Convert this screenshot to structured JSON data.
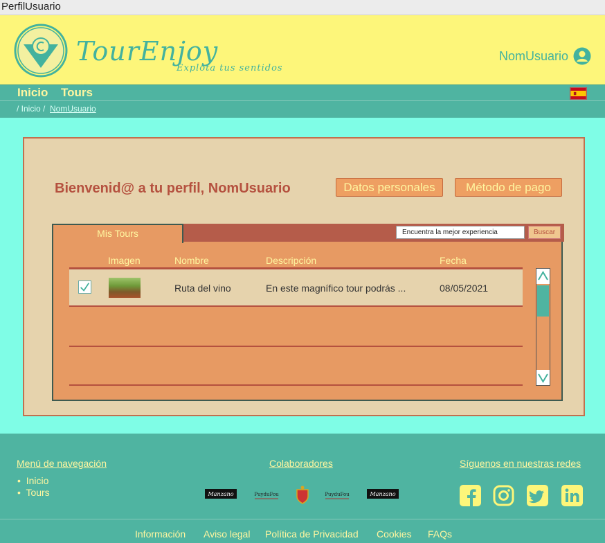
{
  "window": {
    "title": "PerfilUsuario"
  },
  "header": {
    "brand": "TourEnjoy",
    "tagline": "Explota tus sentidos",
    "user": "NomUsuario"
  },
  "nav": {
    "items": [
      "Inicio",
      "Tours"
    ],
    "language": "es"
  },
  "breadcrumb": {
    "root": "/ Inicio /",
    "current": "NomUsuario"
  },
  "profile": {
    "welcome": "Bienvenid@ a tu perfil, NomUsuario",
    "buttons": {
      "personal": "Datos personales",
      "payment": "Método de pago"
    },
    "tab": "Mis Tours",
    "search": {
      "placeholder": "Encuentra la mejor experiencia",
      "button": "Buscar"
    },
    "columns": [
      "Imagen",
      "Nombre",
      "Descripción",
      "Fecha"
    ],
    "rows": [
      {
        "checked": true,
        "name": "Ruta del vino",
        "description": "En este magnífico tour podrás ...",
        "date": "08/05/2021"
      }
    ]
  },
  "footer": {
    "nav_heading": "Menú de navegación",
    "nav_items": [
      "Inicio",
      "Tours"
    ],
    "collab_heading": "Colaboradores",
    "sponsors": [
      "Manzano",
      "PuyduFou",
      "escudo",
      "PuyduFou",
      "Manzano"
    ],
    "social_heading": "Síguenos en nuestras redes",
    "social": [
      "facebook-icon",
      "instagram-icon",
      "twitter-icon",
      "linkedin-icon"
    ],
    "links": [
      "Información",
      "Aviso legal",
      "Política de Privacidad",
      "Cookies",
      "FAQs"
    ]
  },
  "colors": {
    "accent": "#43b29e",
    "teal": "#4fb4a1",
    "yellow": "#fdf67a",
    "orange": "#e79a63"
  }
}
